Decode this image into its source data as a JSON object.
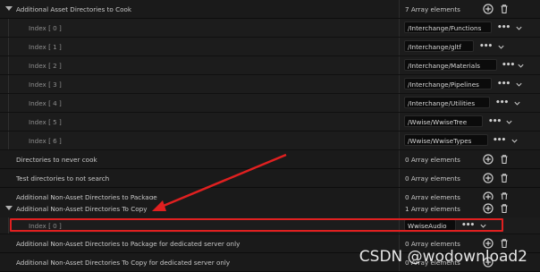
{
  "rows": [
    {
      "label": "Additional Asset Directories to Cook",
      "value": "7 Array elements"
    },
    {
      "label": "Index [ 0 ]",
      "value": "/Interchange/Functions"
    },
    {
      "label": "Index [ 1 ]",
      "value": "/Interchange/gltf"
    },
    {
      "label": "Index [ 2 ]",
      "value": "/Interchange/Materials"
    },
    {
      "label": "Index [ 3 ]",
      "value": "/Interchange/Pipelines"
    },
    {
      "label": "Index [ 4 ]",
      "value": "/Interchange/Utilities"
    },
    {
      "label": "Index [ 5 ]",
      "value": "/Wwise/WwiseTree"
    },
    {
      "label": "Index [ 6 ]",
      "value": "/Wwise/WwiseTypes"
    },
    {
      "label": "Directories to never cook",
      "value": "0 Array elements"
    },
    {
      "label": "Test directories to not search",
      "value": "0 Array elements"
    },
    {
      "label": "Additional Non-Asset Directories to Package",
      "value": "0 Array elements"
    },
    {
      "label": "Additional Non-Asset Directories To Copy",
      "value": "1 Array elements"
    },
    {
      "label": "Index [ 0 ]",
      "value": "WwiseAudio"
    },
    {
      "label": "Additional Non-Asset Directories to Package for dedicated server only",
      "value": "0 Array elements"
    },
    {
      "label": "Additional Non-Asset Directories To Copy for dedicated server only",
      "value": "0 Array elements"
    }
  ],
  "icons": {
    "add": "add-icon",
    "delete": "trash-icon",
    "options": "more-options-icon",
    "dropdown": "chevron-down-icon"
  },
  "annotation": {
    "highlight_color": "#e02020",
    "arrow_color": "#e02020"
  },
  "watermark": "CSDN @wodownload2"
}
